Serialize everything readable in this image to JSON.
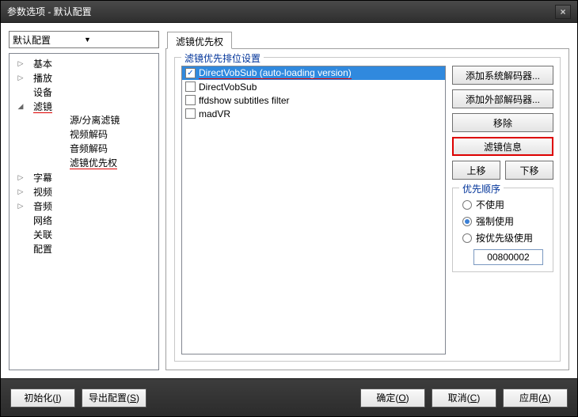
{
  "window": {
    "title": "参数选项 - 默认配置"
  },
  "profile_combo": {
    "value": "默认配置"
  },
  "tree": {
    "basic": "基本",
    "playback": "播放",
    "device": "设备",
    "filter": "滤镜",
    "filter_children": {
      "source_splitter": "源/分离滤镜",
      "video_decode": "视频解码",
      "audio_decode": "音频解码",
      "filter_priority": "滤镜优先权"
    },
    "subtitle": "字幕",
    "video": "视频",
    "audio": "音频",
    "network": "网络",
    "association": "关联",
    "config": "配置"
  },
  "tab": {
    "label": "滤镜优先权"
  },
  "rank": {
    "legend": "滤镜优先排位设置",
    "items": [
      {
        "checked": true,
        "label": "DirectVobSub (auto-loading version)",
        "selected": true,
        "underline": true
      },
      {
        "checked": false,
        "label": "DirectVobSub",
        "selected": false,
        "underline": false
      },
      {
        "checked": false,
        "label": "ffdshow subtitles filter",
        "selected": false,
        "underline": false
      },
      {
        "checked": false,
        "label": "madVR",
        "selected": false,
        "underline": false
      }
    ]
  },
  "buttons": {
    "add_system": "添加系统解码器...",
    "add_external": "添加外部解码器...",
    "remove": "移除",
    "filter_info": "滤镜信息",
    "move_up": "上移",
    "move_down": "下移"
  },
  "priority": {
    "legend": "优先顺序",
    "dont_use": "不使用",
    "force_use": "强制使用",
    "by_priority": "按优先级使用",
    "value": "00800002"
  },
  "footer": {
    "init": "初始化",
    "init_key": "I",
    "export": "导出配置",
    "export_key": "S",
    "ok": "确定",
    "ok_key": "O",
    "cancel": "取消",
    "cancel_key": "C",
    "apply": "应用",
    "apply_key": "A"
  }
}
